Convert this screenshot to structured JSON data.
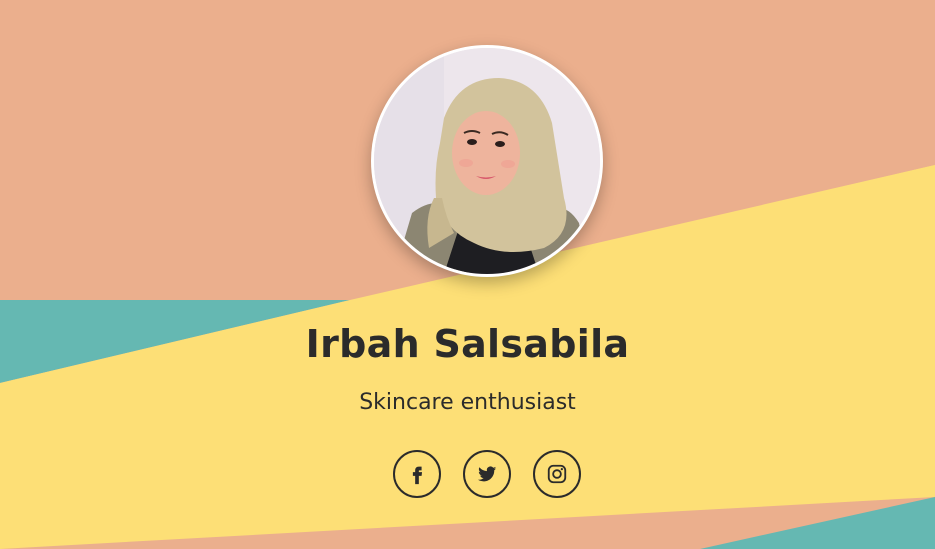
{
  "profile": {
    "name": "Irbah Salsabila",
    "tagline": "Skincare enthusiast"
  },
  "socials": [
    {
      "icon": "facebook-icon"
    },
    {
      "icon": "twitter-icon"
    },
    {
      "icon": "instagram-icon"
    }
  ],
  "colors": {
    "peach": "#EBAF8D",
    "teal": "#65B8B2",
    "yellow": "#FDDF76",
    "text": "#2B2B2B"
  }
}
